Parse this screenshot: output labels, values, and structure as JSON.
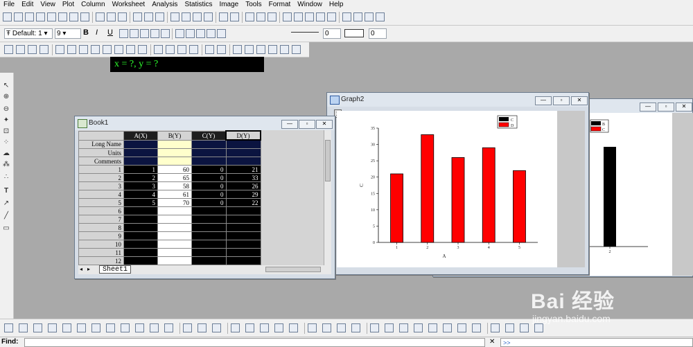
{
  "menu": [
    "File",
    "Edit",
    "View",
    "Plot",
    "Column",
    "Worksheet",
    "Analysis",
    "Statistics",
    "Image",
    "Tools",
    "Format",
    "Window",
    "Help"
  ],
  "format_toolbar": {
    "font_name": "Default: 1",
    "font_size": "9",
    "bold": "B",
    "italic": "I",
    "underline": "U",
    "line_width": "0",
    "border_width": "0"
  },
  "status_display": "x = ?, y = ?",
  "book1": {
    "title": "Book1",
    "columns": [
      "A(X)",
      "B(Y)",
      "C(Y)",
      "D(Y)"
    ],
    "header_rows": [
      "Long Name",
      "Units",
      "Comments"
    ],
    "rows": [
      {
        "n": "1",
        "a": "1",
        "b": "60",
        "c": "0",
        "d": "21"
      },
      {
        "n": "2",
        "a": "2",
        "b": "65",
        "c": "0",
        "d": "33"
      },
      {
        "n": "3",
        "a": "3",
        "b": "58",
        "c": "0",
        "d": "26"
      },
      {
        "n": "4",
        "a": "4",
        "b": "61",
        "c": "0",
        "d": "29"
      },
      {
        "n": "5",
        "a": "5",
        "b": "70",
        "c": "0",
        "d": "22"
      },
      {
        "n": "6",
        "a": "",
        "b": "",
        "c": "",
        "d": ""
      },
      {
        "n": "7",
        "a": "",
        "b": "",
        "c": "",
        "d": ""
      },
      {
        "n": "8",
        "a": "",
        "b": "",
        "c": "",
        "d": ""
      },
      {
        "n": "9",
        "a": "",
        "b": "",
        "c": "",
        "d": ""
      },
      {
        "n": "10",
        "a": "",
        "b": "",
        "c": "",
        "d": ""
      },
      {
        "n": "11",
        "a": "",
        "b": "",
        "c": "",
        "d": ""
      },
      {
        "n": "12",
        "a": "",
        "b": "",
        "c": "",
        "d": ""
      }
    ],
    "sheet_tab": "Sheet1"
  },
  "graph2": {
    "title": "Graph2",
    "layer": "1"
  },
  "colors": {
    "bar_red": "#ff0000",
    "status_green": "#2dff2d",
    "workspace": "#a9a9a9"
  },
  "chart_data": [
    {
      "type": "bar",
      "x": [
        1,
        2,
        3,
        4,
        5
      ],
      "series": [
        {
          "name": "C",
          "values": [
            0,
            0,
            0,
            0,
            0
          ]
        },
        {
          "name": "D",
          "values": [
            21,
            33,
            26,
            29,
            22
          ]
        }
      ],
      "xlabel": "A",
      "ylabel": "C",
      "ylim": [
        0,
        35
      ],
      "yticks": [
        0,
        5,
        10,
        15,
        20,
        25,
        30,
        35
      ],
      "xticks": [
        "1",
        "2",
        "3",
        "4",
        "5"
      ],
      "legend": [
        "C",
        "D"
      ],
      "legend_position": "top-right"
    },
    {
      "type": "bar",
      "x": [
        2
      ],
      "series": [
        {
          "name": "B",
          "values": [
            60
          ]
        }
      ],
      "xticks": [
        "2"
      ],
      "legend": [
        "B",
        "C"
      ],
      "legend_position": "top-left"
    }
  ],
  "find": {
    "label": "Find:",
    "command_prompt": ">>"
  },
  "watermark": {
    "brand": "Bai  经验",
    "url": "jingyan.baidu.com"
  }
}
